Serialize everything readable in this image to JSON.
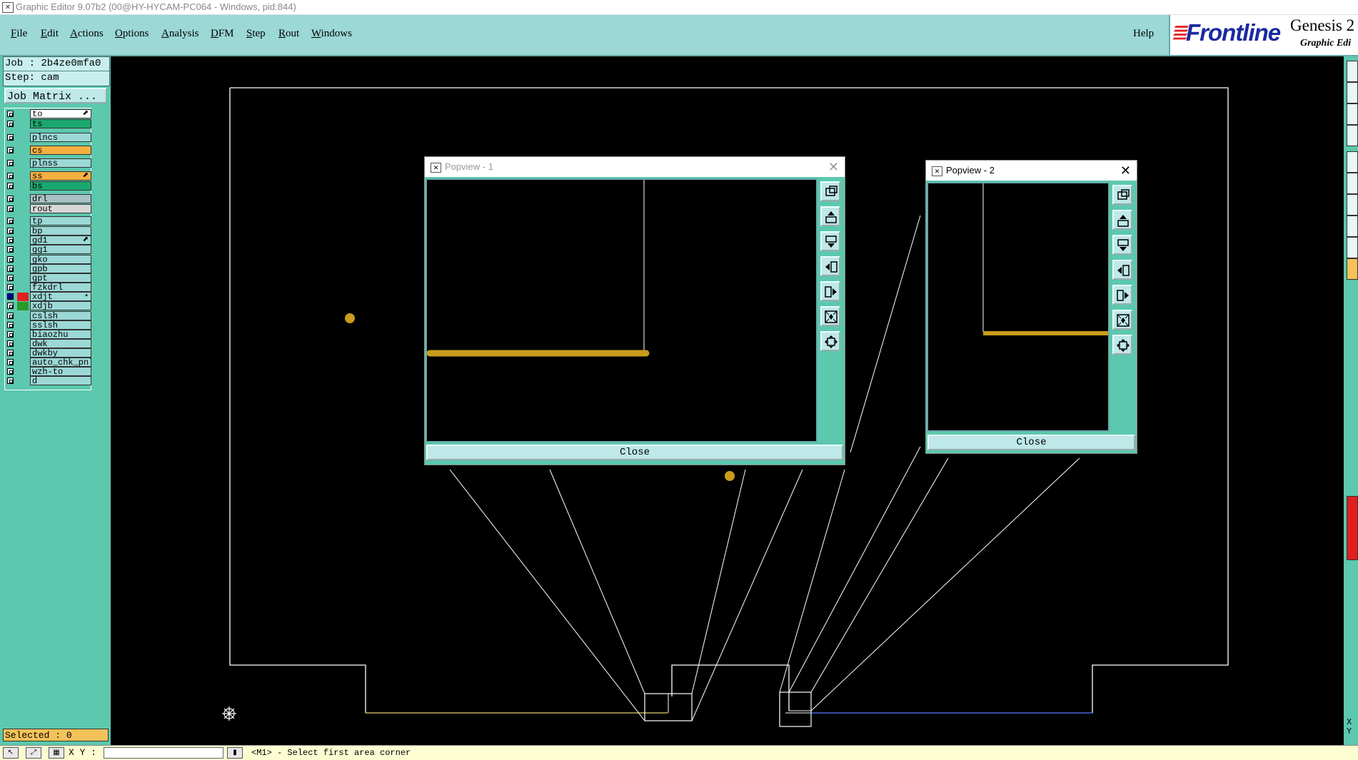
{
  "window": {
    "title": "Graphic Editor 9.07b2 (00@HY-HYCAM-PC064 - Windows, pid:844)"
  },
  "menu": {
    "items": [
      {
        "label": "File",
        "ul": "F",
        "rest": "ile"
      },
      {
        "label": "Edit",
        "ul": "E",
        "rest": "dit"
      },
      {
        "label": "Actions",
        "ul": "A",
        "rest": "ctions"
      },
      {
        "label": "Options",
        "ul": "O",
        "rest": "ptions"
      },
      {
        "label": "Analysis",
        "ul": "A",
        "rest": "nalysis"
      },
      {
        "label": "DFM",
        "ul": "D",
        "rest": "FM"
      },
      {
        "label": "Step",
        "ul": "S",
        "rest": "tep"
      },
      {
        "label": "Rout",
        "ul": "R",
        "rest": "out"
      },
      {
        "label": "Windows",
        "ul": "W",
        "rest": "indows"
      }
    ],
    "help": "Help"
  },
  "brand": {
    "logo": "Frontline",
    "product": "Genesis 2",
    "subtitle": "Graphic Edi"
  },
  "job": {
    "job_line": "Job : 2b4ze0mfa0",
    "step_line": "Step: cam",
    "matrix_button": "Job Matrix ..."
  },
  "layers": [
    {
      "name": "to",
      "color": "#ffffff",
      "checked": false,
      "marker": "⬈"
    },
    {
      "name": "ts",
      "color": "#1aa870",
      "checked": false,
      "marker": ""
    },
    {
      "name": "plncs",
      "color": "#9bd8d6",
      "checked": false,
      "marker": ""
    },
    {
      "name": "cs",
      "color": "#f5b040",
      "checked": false,
      "marker": ""
    },
    {
      "name": "plnss",
      "color": "#9bd8d6",
      "checked": false,
      "marker": ""
    },
    {
      "name": "ss",
      "color": "#f5b040",
      "checked": false,
      "marker": "⬈"
    },
    {
      "name": "bs",
      "color": "#1aa870",
      "checked": false,
      "marker": ""
    },
    {
      "name": "drl",
      "color": "#a8c0c4",
      "checked": false,
      "marker": ""
    },
    {
      "name": "rout",
      "color": "#d8d8d8",
      "checked": false,
      "marker": ""
    },
    {
      "name": "tp",
      "color": "#9bd8d6",
      "checked": false,
      "marker": ""
    },
    {
      "name": "bp",
      "color": "#9bd8d6",
      "checked": false,
      "marker": ""
    },
    {
      "name": "gd1",
      "color": "#9bd8d6",
      "checked": false,
      "marker": "⬈"
    },
    {
      "name": "gg1",
      "color": "#9bd8d6",
      "checked": false,
      "marker": ""
    },
    {
      "name": "gko",
      "color": "#9bd8d6",
      "checked": false,
      "marker": ""
    },
    {
      "name": "gpb",
      "color": "#9bd8d6",
      "checked": false,
      "marker": ""
    },
    {
      "name": "gpt",
      "color": "#9bd8d6",
      "checked": false,
      "marker": ""
    },
    {
      "name": "fzkdrl",
      "color": "#9bd8d6",
      "checked": false,
      "marker": ""
    },
    {
      "name": "xdjt",
      "color": "#9bd8d6",
      "checked": true,
      "marker": "▪",
      "swatch": "#e02020"
    },
    {
      "name": "xdjb",
      "color": "#9bd8d6",
      "checked": false,
      "marker": "",
      "swatch": "#2a9a2a"
    },
    {
      "name": "cslsh",
      "color": "#9bd8d6",
      "checked": false,
      "marker": ""
    },
    {
      "name": "sslsh",
      "color": "#9bd8d6",
      "checked": false,
      "marker": ""
    },
    {
      "name": "biaozhu",
      "color": "#9bd8d6",
      "checked": false,
      "marker": ""
    },
    {
      "name": "dwk",
      "color": "#9bd8d6",
      "checked": false,
      "marker": ""
    },
    {
      "name": "dwkby",
      "color": "#9bd8d6",
      "checked": false,
      "marker": ""
    },
    {
      "name": "auto_chk_pnl",
      "color": "#9bd8d6",
      "checked": false,
      "marker": ""
    },
    {
      "name": "wzh-to",
      "color": "#9bd8d6",
      "checked": false,
      "marker": ""
    },
    {
      "name": "d",
      "color": "#9bd8d6",
      "checked": false,
      "marker": ""
    }
  ],
  "status": {
    "selected": "Selected : 0",
    "xy_label": "X Y :",
    "prompt": "<M1> - Select first area corner",
    "xy_readout": "X\nY"
  },
  "popview1": {
    "title": "Popview - 1",
    "close_label": "Close",
    "close_x": "✕"
  },
  "popview2": {
    "title": "Popview - 2",
    "close_label": "Close",
    "close_x": "✕"
  },
  "colors": {
    "panel_teal": "#5cc8ae",
    "menu_teal": "#9bd8d6",
    "pad_gold": "#c89c1c",
    "selected_orange": "#f5c25a"
  }
}
